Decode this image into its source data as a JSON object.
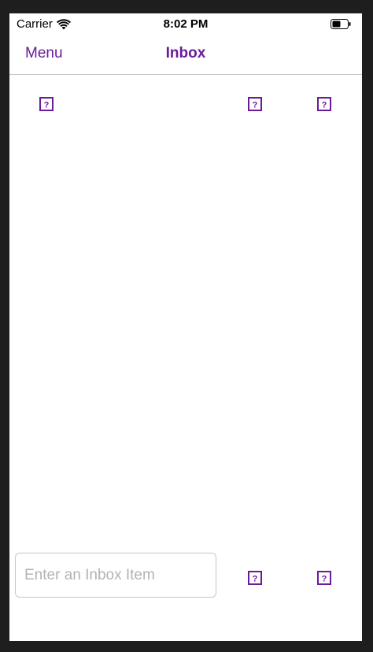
{
  "status_bar": {
    "carrier": "Carrier",
    "time": "8:02 PM"
  },
  "nav": {
    "menu_label": "Menu",
    "title": "Inbox"
  },
  "toolbar_icons": [
    "question-icon",
    "question-icon",
    "question-icon"
  ],
  "bottom_icons": [
    "question-icon",
    "question-icon"
  ],
  "input": {
    "placeholder": "Enter an Inbox Item",
    "value": ""
  },
  "colors": {
    "accent": "#6a1b9a",
    "background": "#ffffff",
    "frame": "#1e1e1e",
    "separator": "#c8c8cc",
    "placeholder": "#b3b3b8"
  }
}
